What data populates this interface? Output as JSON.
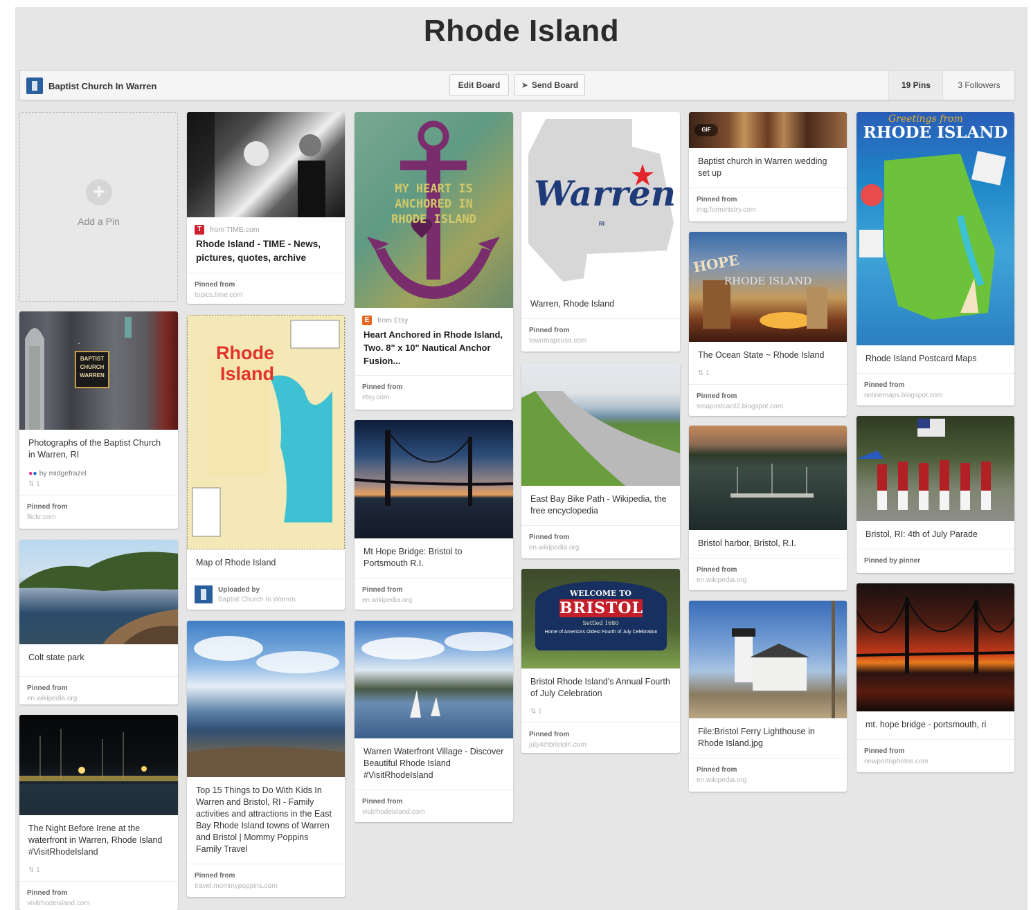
{
  "board": {
    "title": "Rhode Island",
    "owner": "Baptist Church In Warren",
    "edit_label": "Edit Board",
    "send_label": "Send Board",
    "pins_count": "19 Pins",
    "followers_count": "3 Followers",
    "add_pin_label": "Add a Pin"
  },
  "labels": {
    "pinned_from": "Pinned from",
    "pinned_by": "Pinned by pinner",
    "uploaded_by": "Uploaded by",
    "by": "by midgefrazel"
  },
  "pins": {
    "p1": {
      "desc": "Photographs of the Baptist Church in Warren, RI",
      "repins": "1",
      "domain": "flickr.com"
    },
    "p2": {
      "desc": "Colt state park",
      "domain": "en.wikipedia.org"
    },
    "p3": {
      "desc": "The Night Before Irene at the waterfront in Warren, Rhode Island #VisitRhodeIsland",
      "repins": "1",
      "domain": "visitrhodeisland.com"
    },
    "p4": {
      "source": "from TIME.com",
      "desc": "Rhode Island - TIME - News, pictures, quotes, archive",
      "domain": "topics.time.com"
    },
    "p5": {
      "desc": "Map of Rhode Island",
      "uploader": "Baptist Church In Warren"
    },
    "p6": {
      "desc": "Top 15 Things to Do With Kids In Warren and Bristol, RI - Family activities and attractions in the East Bay Rhode Island towns of Warren and Bristol | Mommy Poppins Family Travel",
      "domain": "travel.mommypoppins.com"
    },
    "p7": {
      "source": "from Etsy",
      "desc": "Heart Anchored in Rhode Island, Two. 8\" x 10\" Nautical Anchor Fusion...",
      "domain": "etsy.com"
    },
    "p8": {
      "desc": "Mt Hope Bridge: Bristol to Portsmouth R.I.",
      "domain": "en.wikipedia.org"
    },
    "p9": {
      "desc": "Warren Waterfront Village - Discover Beautiful Rhode Island #VisitRhodeIsland",
      "domain": "visitrhodeisland.com"
    },
    "p10": {
      "desc": "Warren, Rhode Island",
      "domain": "townmapsusa.com"
    },
    "p11": {
      "desc": "East Bay Bike Path - Wikipedia, the free encyclopedia",
      "domain": "en.wikipedia.org"
    },
    "p12": {
      "desc": "Bristol Rhode Island's Annual Fourth of July Celebration",
      "repins": "1",
      "domain": "july4thbristolri.com"
    },
    "p13": {
      "desc": "Baptist church in Warren wedding set up",
      "domain": "img.forministry.com"
    },
    "p14": {
      "desc": "The Ocean State ~ Rhode Island",
      "repins": "1",
      "domain": "smapostcard2.blogspot.com"
    },
    "p15": {
      "desc": "Bristol harbor, Bristol, R.I.",
      "domain": "en.wikipedia.org"
    },
    "p16": {
      "desc": "File:Bristol Ferry Lighthouse in Rhode Island.jpg",
      "domain": "en.wikipedia.org"
    },
    "p17": {
      "desc": "Rhode Island Postcard Maps",
      "domain": "onlinemaps.blogspot.com"
    },
    "p18": {
      "desc": "Bristol, RI: 4th of July Parade"
    },
    "p19": {
      "desc": "mt. hope bridge - portsmouth, ri",
      "domain": "newportriphotos.com"
    }
  },
  "image_text": {
    "church_sign": "BAPTIST CHURCH WARREN",
    "warren": "Warren",
    "warren_ri": "RI",
    "anchor": "MY HEART IS ANCHORED IN RHODE ISLAND",
    "map_title_1": "Rhode",
    "map_title_2": "Island",
    "postcard_top": "Greetings from",
    "postcard": "RHODE ISLAND",
    "ocean_left": "HOPE",
    "ocean": "RHODE ISLAND",
    "bristol_top": "WELCOME TO",
    "bristol": "BRISTOL",
    "bristol_sub": "Settled 1680",
    "bristol_bottom": "Home of America's Oldest Fourth of July Celebration",
    "gif": "GIF"
  },
  "icons": {
    "time": "T",
    "etsy": "E"
  },
  "colors": {
    "time_red": "#d0202e",
    "etsy_orange": "#e8661f",
    "page_bg": "#e6e6e6"
  }
}
